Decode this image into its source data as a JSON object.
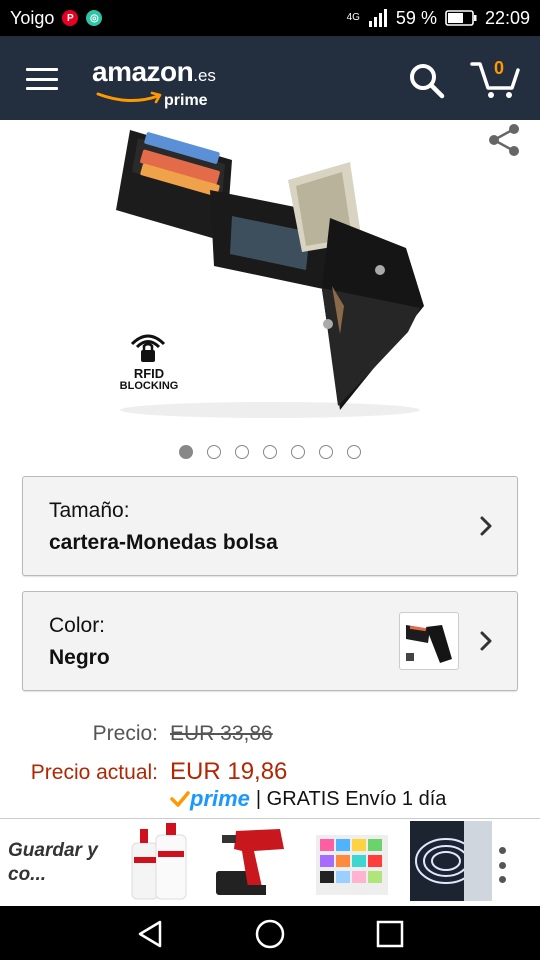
{
  "status_bar": {
    "carrier": "Yoigo",
    "network": "4G",
    "battery": "59 %",
    "time": "22:09"
  },
  "header": {
    "logo_main": "amazon",
    "logo_tld": ".es",
    "logo_prime": "prime",
    "cart_count": "0",
    "icons": [
      "menu-icon",
      "search-icon",
      "cart-icon"
    ]
  },
  "product": {
    "badge_text_1": "RFID",
    "badge_text_2": "BLOCKING",
    "image_index": 1,
    "image_count": 7
  },
  "variations": {
    "size_label": "Tamaño:",
    "size_value": "cartera-Monedas bolsa",
    "color_label": "Color:",
    "color_value": "Negro"
  },
  "price": {
    "list_label": "Precio:",
    "list_value": "EUR 33,86",
    "current_label": "Precio actual:",
    "current_value": "EUR 19,86",
    "prime_word": "prime",
    "shipping": "| GRATIS Envío 1 día"
  },
  "ad": {
    "text": "Guardar y co..."
  },
  "colors": {
    "header_bg": "#232f3e",
    "accent_orange": "#ff9900",
    "price_red": "#b12704",
    "prime_blue": "#1a98ff"
  }
}
